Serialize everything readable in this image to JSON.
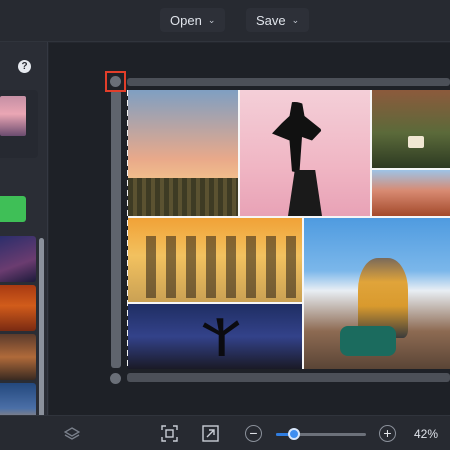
{
  "toolbar": {
    "open_label": "Open",
    "save_label": "Save",
    "chevron": "⌄"
  },
  "sidebar": {
    "help_label": "?"
  },
  "zoom": {
    "percent_label": "42%",
    "level": 0.2,
    "out_label": "−",
    "in_label": "+"
  },
  "icons": {
    "layers": "layers-icon",
    "fit": "fit-to-screen-icon",
    "export": "export-icon"
  },
  "colors": {
    "accent": "#3f8ef0",
    "selection": "#e23e2a",
    "primary_action": "#3fbf57"
  }
}
